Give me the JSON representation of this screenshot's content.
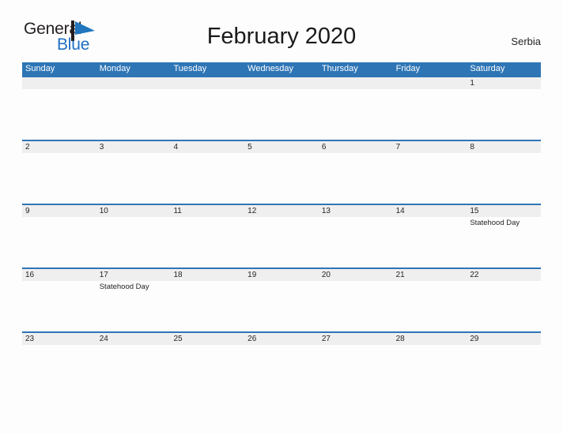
{
  "brand": {
    "word_one": "General",
    "word_two": "Blue",
    "flag_icon": "flag-triangle-icon",
    "color_dark": "#231f20",
    "color_blue": "#1f6fc4"
  },
  "header": {
    "title": "February 2020",
    "country": "Serbia"
  },
  "theme": {
    "header_blue": "#2e75b6",
    "band_gray": "#efefef",
    "page_background": "#fdfdfd",
    "text": "#231f20"
  },
  "calendar": {
    "day_names": [
      "Sunday",
      "Monday",
      "Tuesday",
      "Wednesday",
      "Thursday",
      "Friday",
      "Saturday"
    ],
    "weeks": [
      {
        "days": [
          {
            "num": "",
            "events": []
          },
          {
            "num": "",
            "events": []
          },
          {
            "num": "",
            "events": []
          },
          {
            "num": "",
            "events": []
          },
          {
            "num": "",
            "events": []
          },
          {
            "num": "",
            "events": []
          },
          {
            "num": "1",
            "events": []
          }
        ]
      },
      {
        "days": [
          {
            "num": "2",
            "events": []
          },
          {
            "num": "3",
            "events": []
          },
          {
            "num": "4",
            "events": []
          },
          {
            "num": "5",
            "events": []
          },
          {
            "num": "6",
            "events": []
          },
          {
            "num": "7",
            "events": []
          },
          {
            "num": "8",
            "events": []
          }
        ]
      },
      {
        "days": [
          {
            "num": "9",
            "events": []
          },
          {
            "num": "10",
            "events": []
          },
          {
            "num": "11",
            "events": []
          },
          {
            "num": "12",
            "events": []
          },
          {
            "num": "13",
            "events": []
          },
          {
            "num": "14",
            "events": []
          },
          {
            "num": "15",
            "events": [
              "Statehood Day"
            ]
          }
        ]
      },
      {
        "days": [
          {
            "num": "16",
            "events": []
          },
          {
            "num": "17",
            "events": [
              "Statehood Day"
            ]
          },
          {
            "num": "18",
            "events": []
          },
          {
            "num": "19",
            "events": []
          },
          {
            "num": "20",
            "events": []
          },
          {
            "num": "21",
            "events": []
          },
          {
            "num": "22",
            "events": []
          }
        ]
      },
      {
        "days": [
          {
            "num": "23",
            "events": []
          },
          {
            "num": "24",
            "events": []
          },
          {
            "num": "25",
            "events": []
          },
          {
            "num": "26",
            "events": []
          },
          {
            "num": "27",
            "events": []
          },
          {
            "num": "28",
            "events": []
          },
          {
            "num": "29",
            "events": []
          }
        ]
      }
    ]
  }
}
